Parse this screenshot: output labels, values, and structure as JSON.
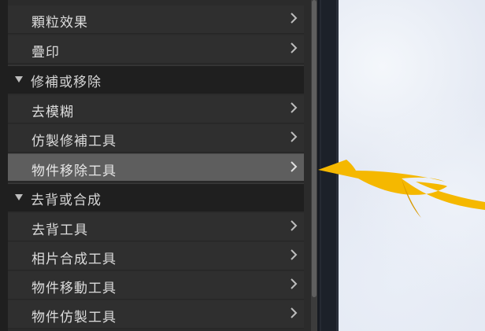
{
  "menu": {
    "items_top": [
      {
        "label": "顆粒效果"
      },
      {
        "label": "疊印"
      }
    ],
    "sections": [
      {
        "title": "修補或移除",
        "items": [
          {
            "label": "去模糊",
            "selected": false
          },
          {
            "label": "仿製修補工具",
            "selected": false
          },
          {
            "label": "物件移除工具",
            "selected": true
          }
        ]
      },
      {
        "title": "去背或合成",
        "items": [
          {
            "label": "去背工具",
            "selected": false
          },
          {
            "label": "相片合成工具",
            "selected": false
          },
          {
            "label": "物件移動工具",
            "selected": false
          },
          {
            "label": "物件仿製工具",
            "selected": false
          }
        ]
      }
    ]
  },
  "annotation": {
    "color": "#f5b800",
    "icon": "arrow-pointer-icon"
  },
  "colors": {
    "selected_row": "#5e5e5e",
    "row_bg": "#2f2f2f",
    "section_bg": "#1f1f1f"
  }
}
